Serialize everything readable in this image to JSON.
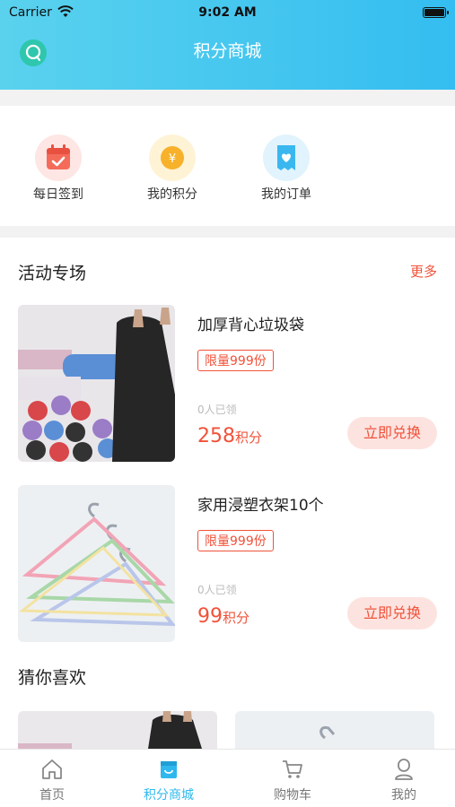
{
  "status_bar": {
    "carrier": "Carrier",
    "time": "9:02 AM"
  },
  "header": {
    "title": "积分商城"
  },
  "quick_entries": [
    {
      "label": "每日签到",
      "icon": "calendar-check-icon"
    },
    {
      "label": "我的积分",
      "icon": "yen-coin-icon"
    },
    {
      "label": "我的订单",
      "icon": "heart-ticket-icon"
    }
  ],
  "activity": {
    "title": "活动专场",
    "more": "更多",
    "products": [
      {
        "name": "加厚背心垃圾袋",
        "limit": "限量999份",
        "claimed": "0人已领",
        "points": "258",
        "points_unit": "积分",
        "redeem": "立即兑换"
      },
      {
        "name": "家用浸塑衣架10个",
        "limit": "限量999份",
        "claimed": "0人已领",
        "points": "99",
        "points_unit": "积分",
        "redeem": "立即兑换"
      }
    ]
  },
  "recommend": {
    "title": "猜你喜欢"
  },
  "tabs": [
    {
      "label": "首页",
      "icon": "home-icon",
      "active": false
    },
    {
      "label": "积分商城",
      "icon": "store-icon",
      "active": true
    },
    {
      "label": "购物车",
      "icon": "cart-icon",
      "active": false
    },
    {
      "label": "我的",
      "icon": "user-icon",
      "active": false
    }
  ],
  "colors": {
    "header_start": "#5ad2ee",
    "header_end": "#34bdf0",
    "accent": "#f0523a",
    "tab_active": "#2eb8ee"
  }
}
